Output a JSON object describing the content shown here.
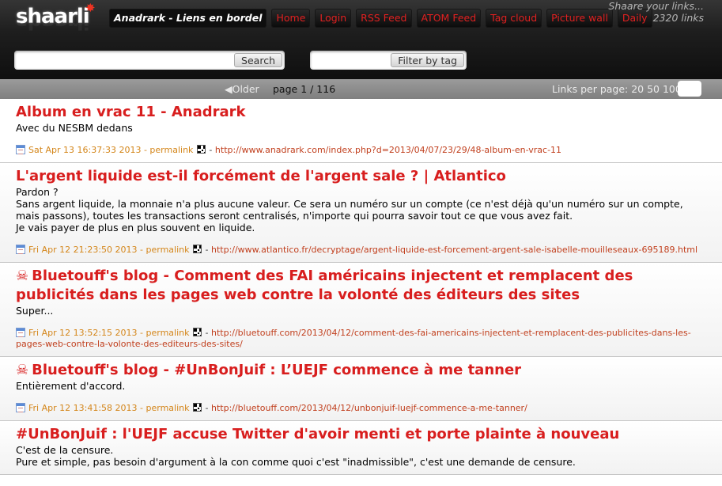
{
  "header": {
    "logo_text": "shaarli",
    "site_title": "Anadrark - Liens en bordel",
    "nav": [
      "Home",
      "Login",
      "RSS Feed",
      "ATOM Feed",
      "Tag cloud",
      "Picture wall",
      "Daily"
    ],
    "tagline": "Shaare your links...",
    "link_count": "2320 links"
  },
  "search": {
    "search_button": "Search",
    "tag_button": "Filter by tag",
    "search_value": "",
    "tag_value": ""
  },
  "paging": {
    "older": "Older",
    "page_label": "page 1 / 116",
    "links_per_page": "Links per page: 20 50 100"
  },
  "links": [
    {
      "title": "Album en vrac 11 - Anadrark",
      "description": [
        "Avec du NESBM dedans"
      ],
      "date": "Sat Apr 13 16:37:33 2013",
      "permalink": "permalink",
      "url": "http://www.anadrark.com/index.php?d=2013/04/07/23/29/48-album-en-vrac-11",
      "skull": false
    },
    {
      "title": "L'argent liquide est-il forcément de l'argent sale ? | Atlantico",
      "description": [
        "Pardon ?",
        "Sans argent liquide, la monnaie n'a plus aucune valeur. Ce sera un numéro sur un compte (ce n'est déjà qu'un numéro sur un compte, mais passons), toutes les transactions seront centralisés, n'importe qui pourra savoir tout ce que vous avez fait.",
        "Je vais payer de plus en plus souvent en liquide."
      ],
      "date": "Fri Apr 12 21:23:50 2013",
      "permalink": "permalink",
      "url": "http://www.atlantico.fr/decryptage/argent-liquide-est-forcement-argent-sale-isabelle-mouilleseaux-695189.html",
      "skull": false
    },
    {
      "title": "Bluetouff's blog - Comment des FAI américains injectent et remplacent des publicités dans les pages web contre la volonté des éditeurs des sites",
      "description": [
        "Super..."
      ],
      "date": "Fri Apr 12 13:52:15 2013",
      "permalink": "permalink",
      "url": "http://bluetouff.com/2013/04/12/comment-des-fai-americains-injectent-et-remplacent-des-publicites-dans-les-pages-web-contre-la-volonte-des-editeurs-des-sites/",
      "skull": true
    },
    {
      "title": "Bluetouff's blog - #UnBonJuif : L’UEJF commence à me tanner",
      "description": [
        "Entièrement d'accord."
      ],
      "date": "Fri Apr 12 13:41:58 2013",
      "permalink": "permalink",
      "url": "http://bluetouff.com/2013/04/12/unbonjuif-luejf-commence-a-me-tanner/",
      "skull": true
    },
    {
      "title": "#UnBonJuif : l'UEJF accuse Twitter d'avoir menti et porte plainte à nouveau",
      "description": [
        "C'est de la censure.",
        "Pure et simple, pas besoin d'argument à la con comme quoi c'est \"inadmissible\", c'est une demande de censure."
      ],
      "date": "",
      "permalink": "",
      "url": "",
      "skull": false
    }
  ],
  "colors": {
    "title_red": "#d81e1e",
    "date_orange": "#d4861a",
    "url_red": "#c13f1d",
    "header_dark": "#1e1e1e"
  }
}
